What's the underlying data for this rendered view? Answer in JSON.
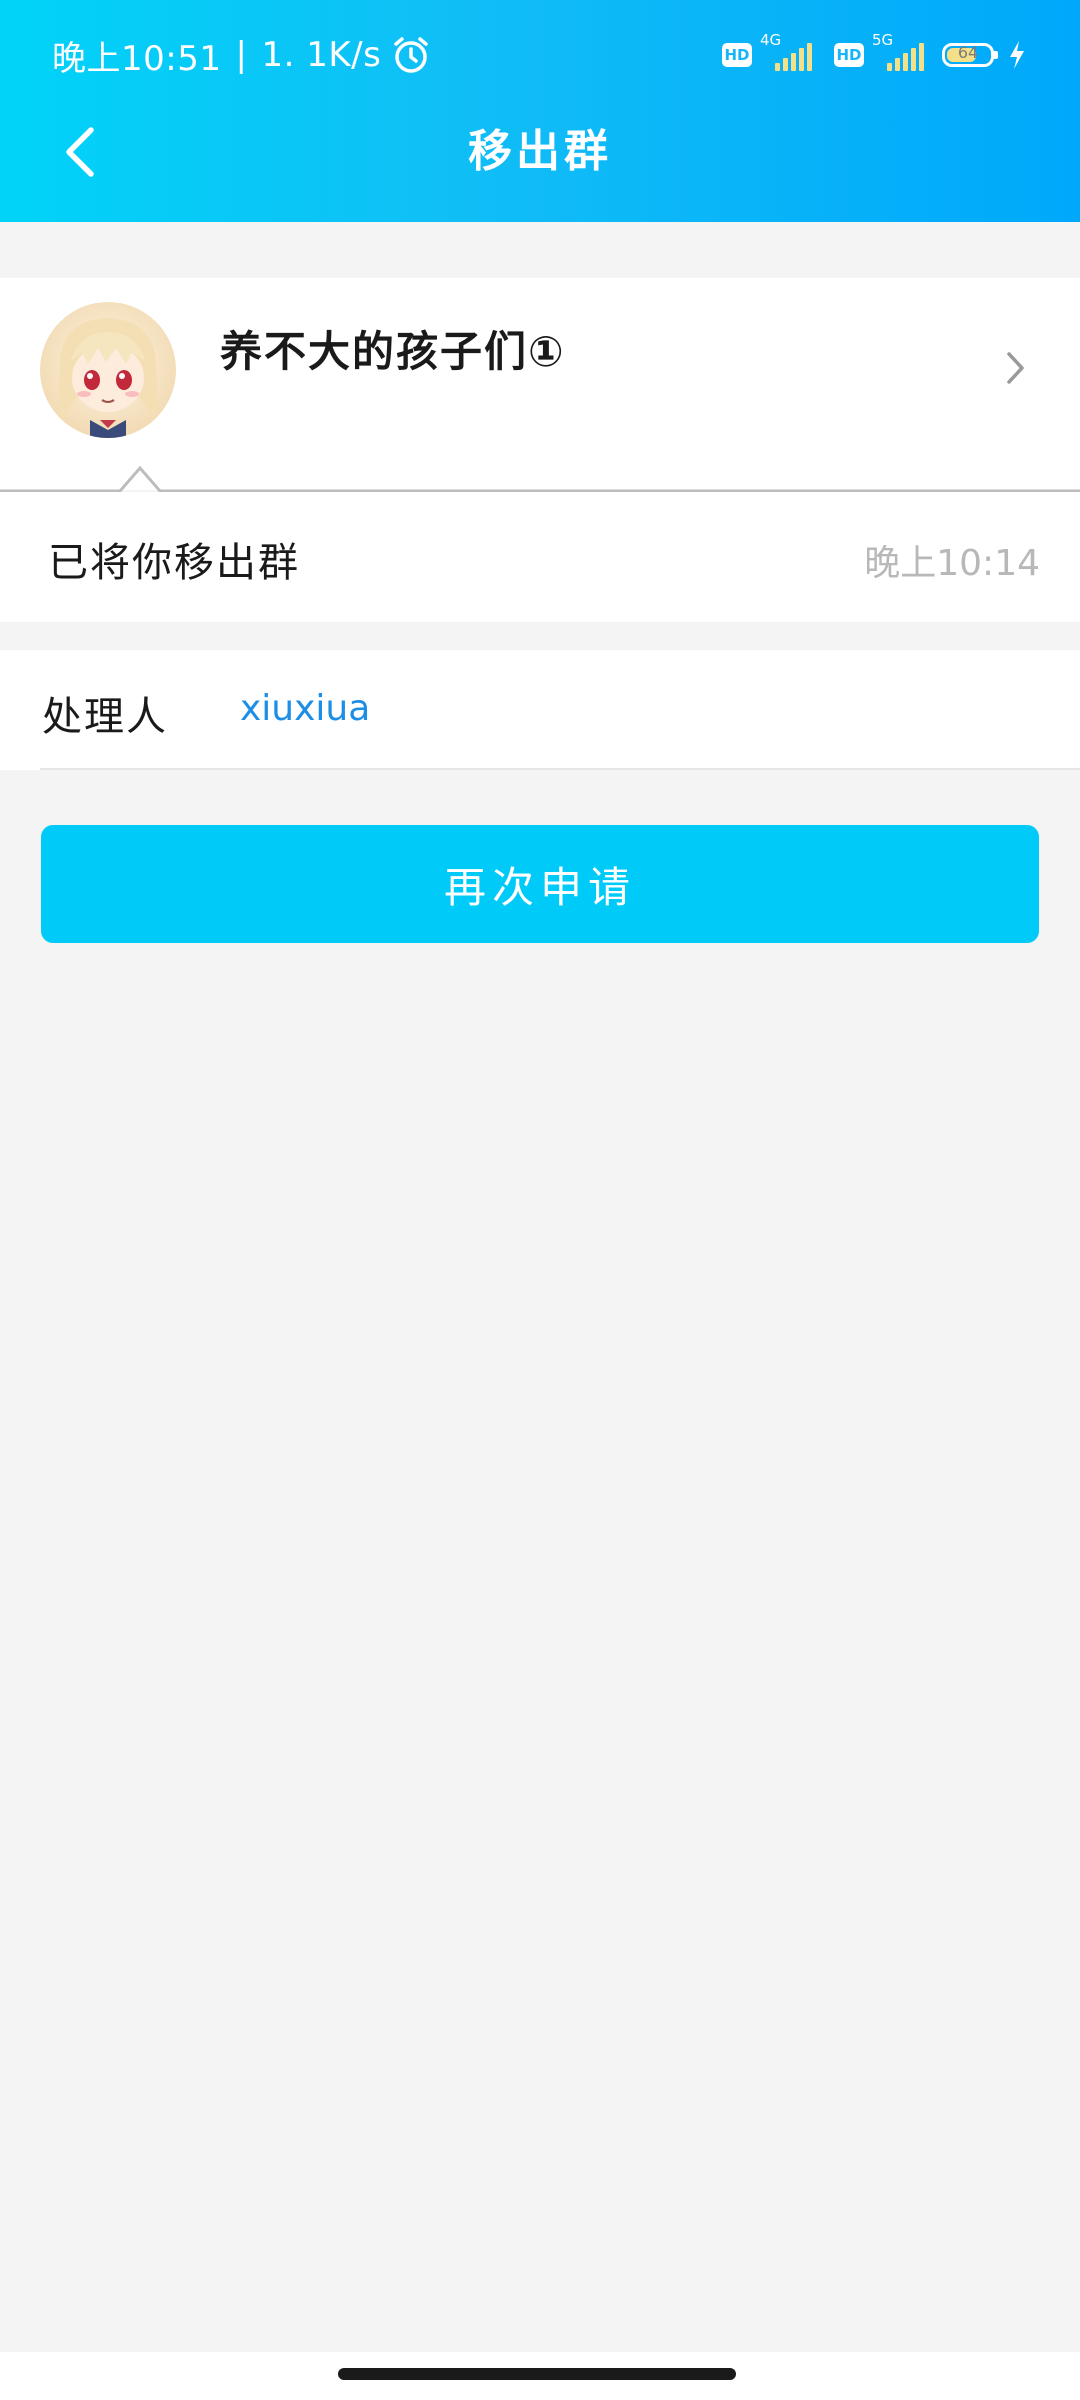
{
  "status_bar": {
    "time": "晚上10:51",
    "separator": "|",
    "net_speed": "1. 1K/s",
    "hd_label": "HD",
    "sim1_network": "4G",
    "sim2_network": "5G",
    "battery_level": "64"
  },
  "header": {
    "title": "移出群"
  },
  "group": {
    "name": "养不大的孩子们①"
  },
  "message": {
    "text": "已将你移出群",
    "time": "晚上10:14"
  },
  "handler": {
    "label": "处理人",
    "value": "xiuxiua"
  },
  "actions": {
    "reapply_label": "再次申请"
  },
  "colors": {
    "header_start": "#00d3f8",
    "header_end": "#00a8fb",
    "button": "#00cbf8",
    "link": "#1c8ee6",
    "background": "#f4f4f4"
  }
}
